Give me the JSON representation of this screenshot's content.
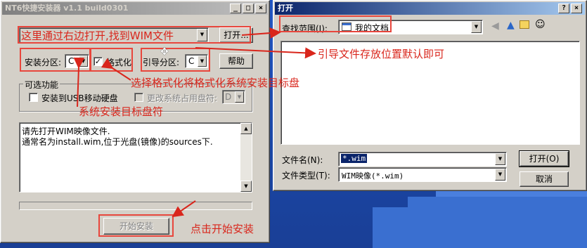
{
  "main_window": {
    "title": "NT6快捷安装器 v1.1 build0301",
    "open_button": "打开...",
    "help_button": "帮助",
    "install_partition_label": "安装分区:",
    "install_partition_value": "C",
    "format_label": "格式化",
    "boot_partition_label": "引导分区:",
    "boot_partition_value": "C",
    "options_group": "可选功能",
    "usb_option": "安装到USB移动硬盘",
    "change_drive_option": "更改系统占用盘符:",
    "change_drive_value": "D",
    "log_line1": "请先打开WIM映像文件.",
    "log_line2": "通常名为install.wim,位于光盘(镜像)的sources下.",
    "start_button": "开始安装"
  },
  "open_dialog": {
    "title": "打开",
    "look_in_label": "查找范围(I):",
    "look_in_value": "我的文档",
    "filename_label": "文件名(N):",
    "filename_value": "*.wim",
    "filetype_label": "文件类型(T):",
    "filetype_value": "WIM映像(*.wim)",
    "open_button": "打开(O)",
    "cancel_button": "取消",
    "help_btn": "?",
    "close_btn": "×"
  },
  "window_controls": {
    "minimize": "_",
    "maximize": "□",
    "close": "×"
  },
  "annotations": {
    "open_wim": "这里通过右边打开,找到WIM文件",
    "boot_location": "引导文件存放位置默认即可",
    "format_target": "选择格式化将格式化系统安装目标盘",
    "target_disk": "系统安装目标盘符",
    "click_start": "点击开始安装"
  },
  "colors": {
    "annotation": "#d9261c",
    "title_active": "#0a246a",
    "desktop": "#1c4aa7"
  }
}
